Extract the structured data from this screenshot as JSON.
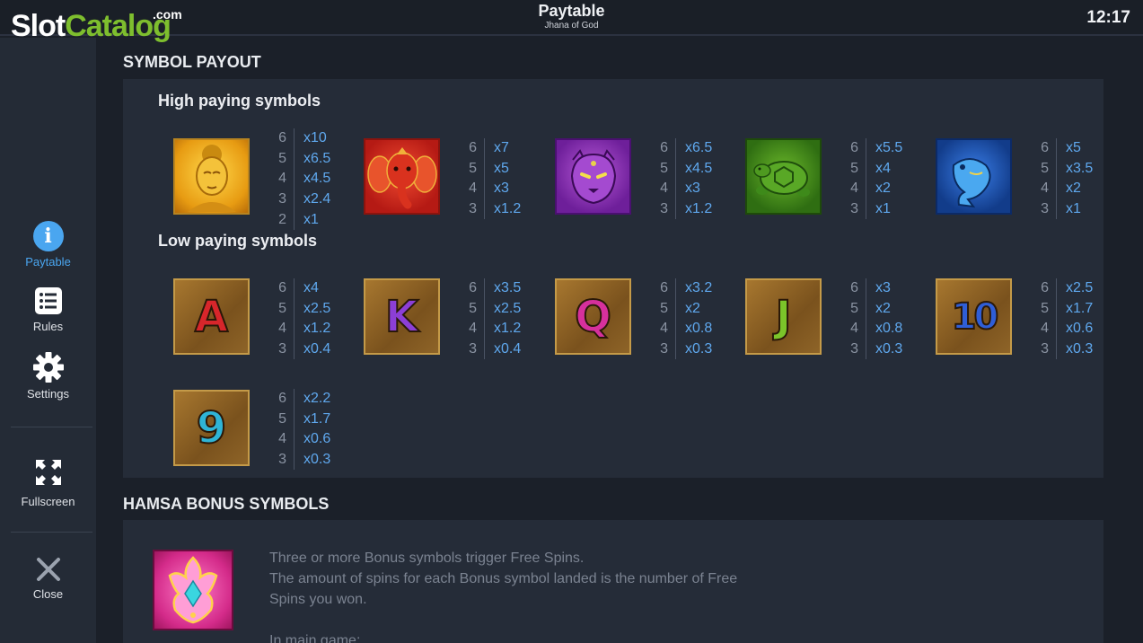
{
  "header": {
    "title": "Paytable",
    "subtitle": "Jhana of God",
    "clock": "12:17"
  },
  "watermark": {
    "slot": "Slot",
    "catalog": "Catalog",
    "com": ".com"
  },
  "sidebar": {
    "items": [
      {
        "label": "Paytable"
      },
      {
        "label": "Rules"
      },
      {
        "label": "Settings"
      },
      {
        "label": "Fullscreen"
      },
      {
        "label": "Close"
      }
    ]
  },
  "symbol_payout": {
    "title": "SYMBOL PAYOUT",
    "high_title": "High paying symbols",
    "low_title": "Low paying symbols",
    "high": [
      {
        "name": "buddha-symbol",
        "counts": [
          "6",
          "5",
          "4",
          "3",
          "2"
        ],
        "payouts": [
          "x10",
          "x6.5",
          "x4.5",
          "x2.4",
          "x1"
        ]
      },
      {
        "name": "elephant-symbol",
        "counts": [
          "6",
          "5",
          "4",
          "3"
        ],
        "payouts": [
          "x7",
          "x5",
          "x3",
          "x1.2"
        ]
      },
      {
        "name": "panther-symbol",
        "counts": [
          "6",
          "5",
          "4",
          "3"
        ],
        "payouts": [
          "x6.5",
          "x4.5",
          "x3",
          "x1.2"
        ]
      },
      {
        "name": "turtle-symbol",
        "counts": [
          "6",
          "5",
          "4",
          "3"
        ],
        "payouts": [
          "x5.5",
          "x4",
          "x2",
          "x1"
        ]
      },
      {
        "name": "fish-symbol",
        "counts": [
          "6",
          "5",
          "4",
          "3"
        ],
        "payouts": [
          "x5",
          "x3.5",
          "x2",
          "x1"
        ]
      }
    ],
    "low": [
      {
        "letter": "A",
        "color": "#d8262b",
        "counts": [
          "6",
          "5",
          "4",
          "3"
        ],
        "payouts": [
          "x4",
          "x2.5",
          "x1.2",
          "x0.4"
        ]
      },
      {
        "letter": "K",
        "color": "#8c3fd6",
        "counts": [
          "6",
          "5",
          "4",
          "3"
        ],
        "payouts": [
          "x3.5",
          "x2.5",
          "x1.2",
          "x0.4"
        ]
      },
      {
        "letter": "Q",
        "color": "#d6309c",
        "counts": [
          "6",
          "5",
          "4",
          "3"
        ],
        "payouts": [
          "x3.2",
          "x2",
          "x0.8",
          "x0.3"
        ]
      },
      {
        "letter": "J",
        "color": "#7bc42a",
        "counts": [
          "6",
          "5",
          "4",
          "3"
        ],
        "payouts": [
          "x3",
          "x2",
          "x0.8",
          "x0.3"
        ]
      },
      {
        "letter": "10",
        "color": "#2f5ed6",
        "counts": [
          "6",
          "5",
          "4",
          "3"
        ],
        "payouts": [
          "x2.5",
          "x1.7",
          "x0.6",
          "x0.3"
        ]
      },
      {
        "letter": "9",
        "color": "#2fb4d6",
        "counts": [
          "6",
          "5",
          "4",
          "3"
        ],
        "payouts": [
          "x2.2",
          "x1.7",
          "x0.6",
          "x0.3"
        ]
      }
    ]
  },
  "bonus": {
    "title": "HAMSA BONUS SYMBOLS",
    "line1": "Three or more Bonus symbols trigger Free Spins.",
    "line2": "The amount of spins for each Bonus symbol landed is the number of Free",
    "line3": "Spins you won.",
    "line4": "In main game:"
  },
  "colors": {
    "accent": "#4aa6f0",
    "payout": "#5fa8ee",
    "watermark_green": "#7ebe2e"
  }
}
